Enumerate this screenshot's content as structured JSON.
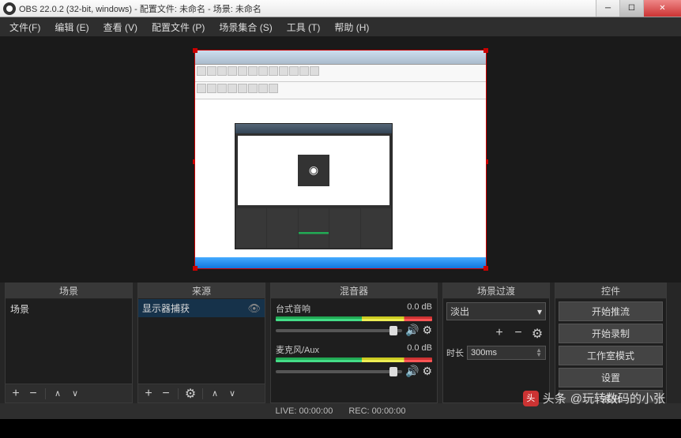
{
  "window": {
    "title": "OBS 22.0.2 (32-bit, windows) - 配置文件: 未命名 - 场景: 未命名"
  },
  "menu": {
    "file": "文件(F)",
    "edit": "编辑 (E)",
    "view": "查看 (V)",
    "profile": "配置文件 (P)",
    "scene_col": "场景集合 (S)",
    "tools": "工具 (T)",
    "help": "帮助 (H)"
  },
  "panels": {
    "scenes": "场景",
    "sources": "来源",
    "mixer": "混音器",
    "transitions": "场景过渡",
    "controls": "控件"
  },
  "scenes": {
    "items": [
      "场景"
    ]
  },
  "sources": {
    "items": [
      {
        "label": "显示器捕获"
      }
    ]
  },
  "mixer": {
    "channels": [
      {
        "name": "台式音响",
        "db": "0.0 dB"
      },
      {
        "name": "麦克风/Aux",
        "db": "0.0 dB"
      }
    ]
  },
  "transitions": {
    "selected": "淡出",
    "duration_label": "时长",
    "duration_value": "300ms"
  },
  "controls": {
    "start_stream": "开始推流",
    "start_record": "开始录制",
    "studio_mode": "工作室模式",
    "settings": "设置",
    "exit": "退出"
  },
  "status": {
    "live": "LIVE: 00:00:00",
    "rec": "REC: 00:00:00"
  },
  "watermark": {
    "prefix": "头条",
    "text": "@玩转数码的小张"
  }
}
